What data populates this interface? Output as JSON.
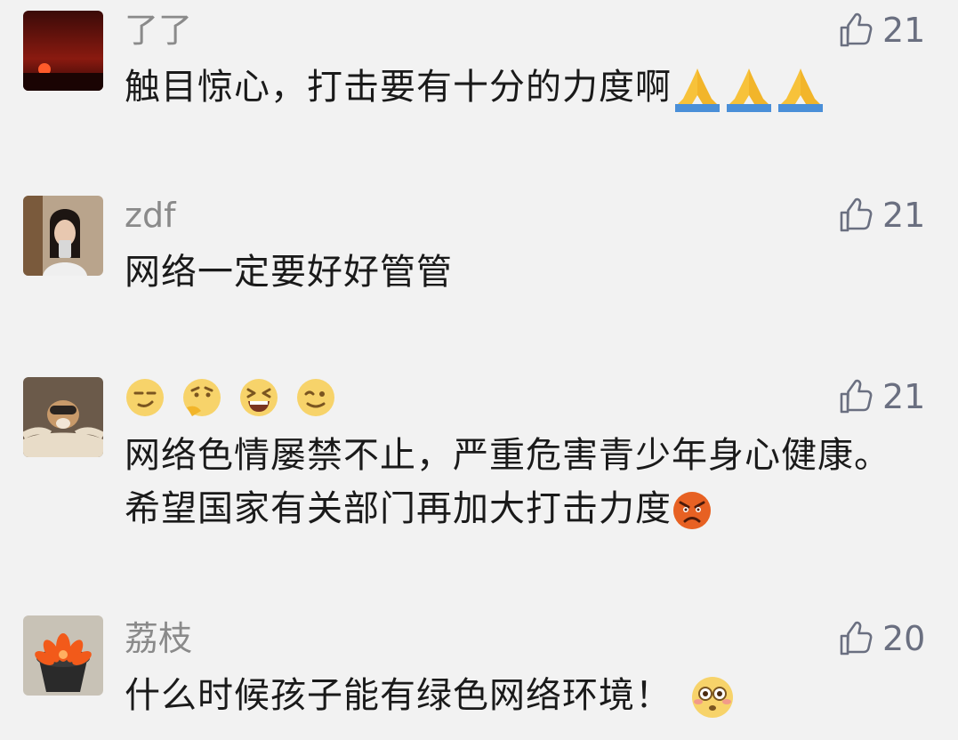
{
  "comments": [
    {
      "author": "了了",
      "likes": "21",
      "text": "触目惊心，打击要有十分的力度啊",
      "trailing_emojis": [
        "pray-emoji",
        "pray-emoji",
        "pray-emoji"
      ]
    },
    {
      "author": "zdf",
      "likes": "21",
      "text": "网络一定要好好管管"
    },
    {
      "author_emojis": [
        "smirk-emoji",
        "thinking-emoji",
        "laughing-emoji",
        "wink-emoji"
      ],
      "likes": "21",
      "text": "网络色情屡禁不止，严重危害青少年身心健康。希望国家有关部门再加大打击力度",
      "trailing_emojis": [
        "angry-emoji"
      ]
    },
    {
      "author": "荔枝",
      "likes": "20",
      "text": "什么时候孩子能有绿色网络环境！",
      "trailing_emojis": [
        "flushed-emoji"
      ]
    }
  ],
  "colors": {
    "background": "#f2f2f2",
    "name": "#8a8a8a",
    "like": "#6a6f80",
    "text": "#1a1a1a"
  }
}
